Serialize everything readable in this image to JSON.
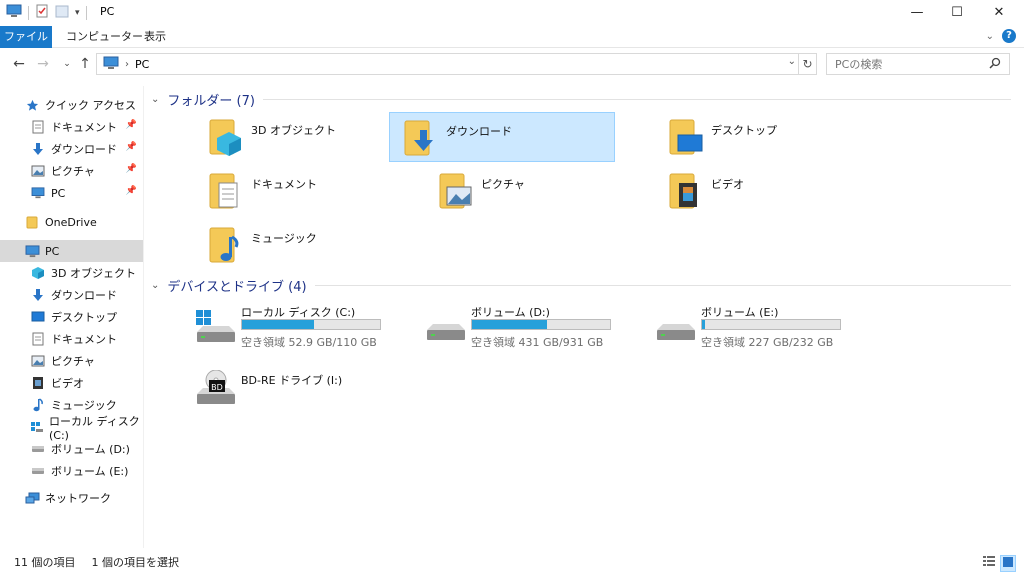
{
  "window": {
    "title": "PC"
  },
  "ribbon": {
    "tabs": [
      "ファイル",
      "コンピューター",
      "表示"
    ],
    "help": "?"
  },
  "address": {
    "path": "PC",
    "search_placeholder": "PCの検索"
  },
  "sidebar": {
    "items": [
      {
        "label": "クイック アクセス",
        "icon": "star-icon"
      },
      {
        "label": "ドキュメント",
        "icon": "documents-icon",
        "pinned": true
      },
      {
        "label": "ダウンロード",
        "icon": "download-icon",
        "pinned": true
      },
      {
        "label": "ピクチャ",
        "icon": "pictures-icon",
        "pinned": true
      },
      {
        "label": "PC",
        "icon": "pc-icon",
        "pinned": true
      },
      {
        "label": "OneDrive",
        "icon": "folder-icon"
      },
      {
        "label": "PC",
        "icon": "pc-icon",
        "selected": true
      },
      {
        "label": "3D オブジェクト",
        "icon": "3d-objects-icon"
      },
      {
        "label": "ダウンロード",
        "icon": "download-icon"
      },
      {
        "label": "デスクトップ",
        "icon": "desktop-icon"
      },
      {
        "label": "ドキュメント",
        "icon": "documents-icon"
      },
      {
        "label": "ピクチャ",
        "icon": "pictures-icon"
      },
      {
        "label": "ビデオ",
        "icon": "video-icon"
      },
      {
        "label": "ミュージック",
        "icon": "music-icon"
      },
      {
        "label": "ローカル ディスク (C:)",
        "icon": "windows-drive-icon"
      },
      {
        "label": "ボリューム (D:)",
        "icon": "drive-icon"
      },
      {
        "label": "ボリューム (E:)",
        "icon": "drive-icon"
      },
      {
        "label": "ネットワーク",
        "icon": "network-icon"
      }
    ]
  },
  "folders": {
    "header": "フォルダー (7)",
    "items": [
      {
        "label": "3D オブジェクト",
        "icon": "3d-objects-folder-icon"
      },
      {
        "label": "ダウンロード",
        "icon": "downloads-folder-icon",
        "selected": true
      },
      {
        "label": "デスクトップ",
        "icon": "desktop-folder-icon"
      },
      {
        "label": "ドキュメント",
        "icon": "documents-folder-icon"
      },
      {
        "label": "ピクチャ",
        "icon": "pictures-folder-icon"
      },
      {
        "label": "ビデオ",
        "icon": "videos-folder-icon"
      },
      {
        "label": "ミュージック",
        "icon": "music-folder-icon"
      }
    ]
  },
  "drives": {
    "header": "デバイスとドライブ (4)",
    "items": [
      {
        "label": "ローカル ディスク (C:)",
        "free": "空き領域 52.9 GB/110 GB",
        "used_fraction": 0.52,
        "icon": "windows-drive-icon"
      },
      {
        "label": "ボリューム (D:)",
        "free": "空き領域 431 GB/931 GB",
        "used_fraction": 0.54,
        "icon": "drive-icon"
      },
      {
        "label": "ボリューム (E:)",
        "free": "空き領域 227 GB/232 GB",
        "used_fraction": 0.02,
        "icon": "drive-icon"
      },
      {
        "label": "BD-RE ドライブ (I:)",
        "icon": "bd-drive-icon",
        "badge": "BD"
      }
    ]
  },
  "status": {
    "item_count": "11 個の項目",
    "selection": "1 個の項目を選択"
  },
  "colors": {
    "accent": "#1979ca",
    "selection": "#cce8ff",
    "bar_fill": "#26a0da",
    "group_header": "#1e3287"
  }
}
